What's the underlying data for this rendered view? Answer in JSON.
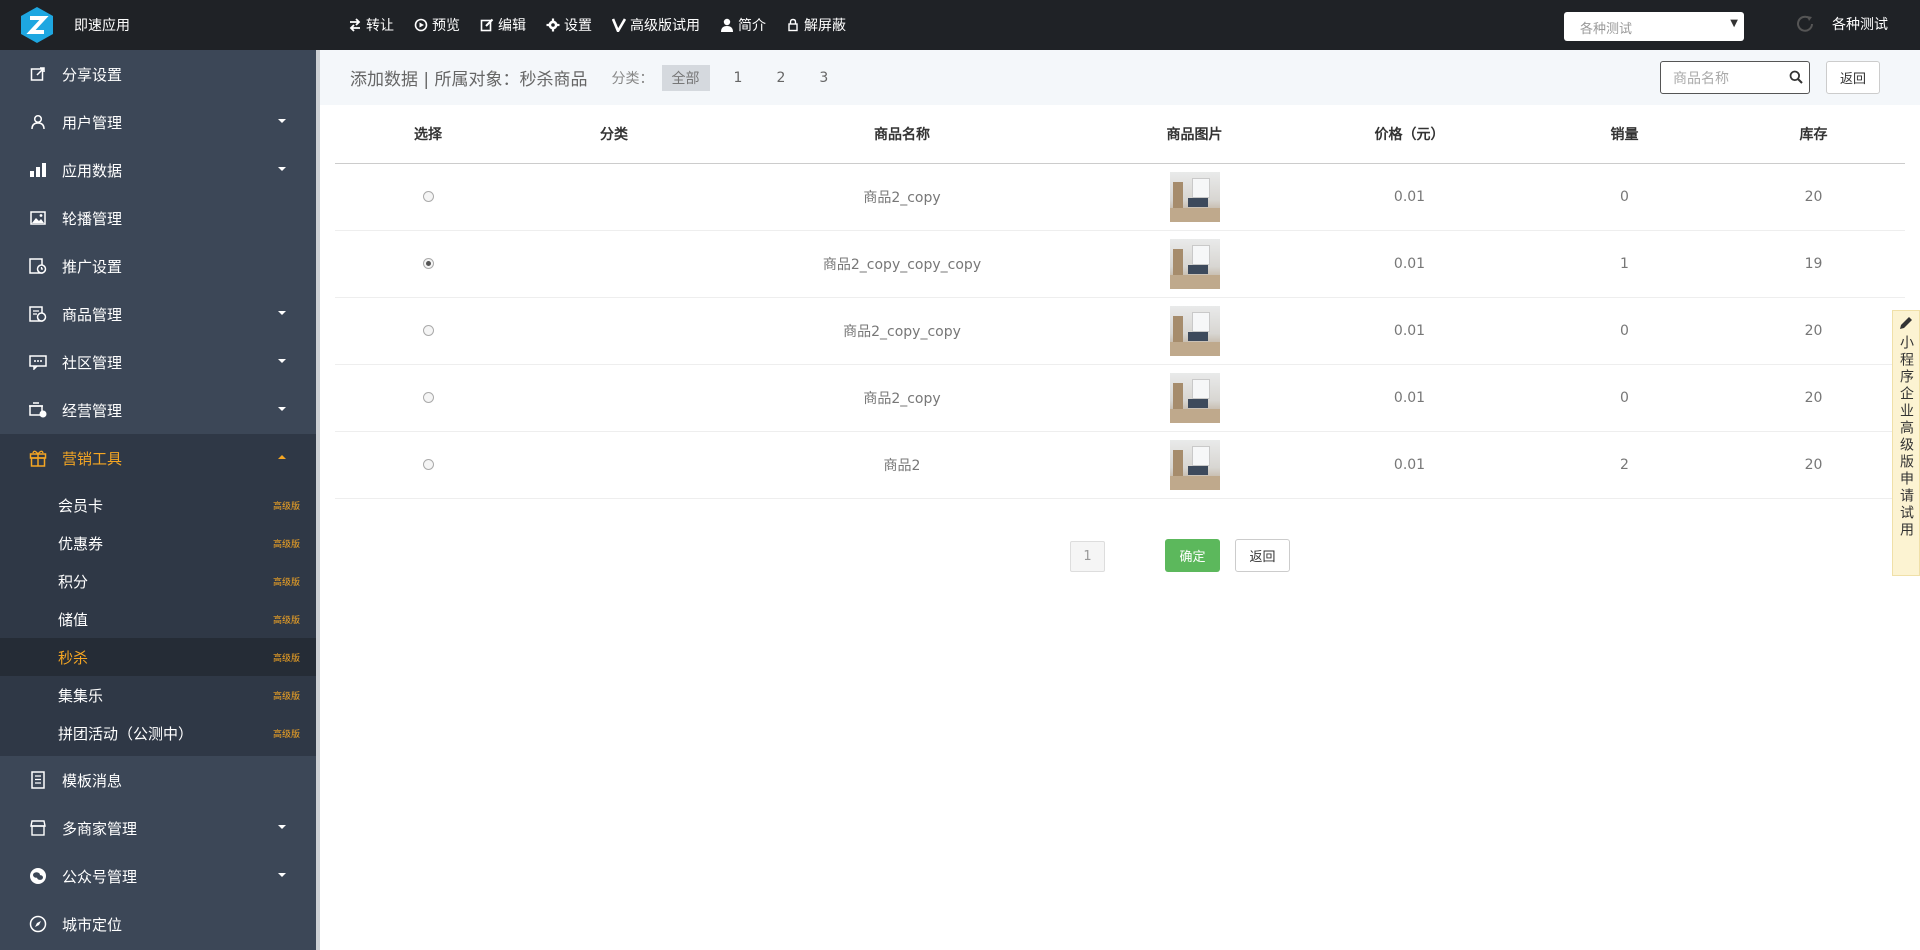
{
  "app": {
    "name": "即速应用",
    "accent": "#f5a623"
  },
  "topnav": [
    {
      "label": "转让",
      "icon": "transfer-icon"
    },
    {
      "label": "预览",
      "icon": "play-circle-icon"
    },
    {
      "label": "编辑",
      "icon": "edit-icon"
    },
    {
      "label": "设置",
      "icon": "gear-icon"
    },
    {
      "label": "高级版试用",
      "icon": "v-icon"
    },
    {
      "label": "简介",
      "icon": "user-icon"
    },
    {
      "label": "解屏蔽",
      "icon": "lock-icon"
    }
  ],
  "top_select": {
    "value": "各种测试"
  },
  "top_user": {
    "label": "各种测试"
  },
  "sidebar": {
    "items": [
      {
        "label": "分享设置",
        "icon": "share-icon",
        "has_arrow": false
      },
      {
        "label": "用户管理",
        "icon": "user-icon",
        "has_arrow": true
      },
      {
        "label": "应用数据",
        "icon": "bar-chart-icon",
        "has_arrow": true
      },
      {
        "label": "轮播管理",
        "icon": "image-icon",
        "has_arrow": false
      },
      {
        "label": "推广设置",
        "icon": "promote-icon",
        "has_arrow": false
      },
      {
        "label": "商品管理",
        "icon": "goods-icon",
        "has_arrow": true
      },
      {
        "label": "社区管理",
        "icon": "community-icon",
        "has_arrow": true
      },
      {
        "label": "经营管理",
        "icon": "business-icon",
        "has_arrow": true
      },
      {
        "label": "营销工具",
        "icon": "gift-icon",
        "has_arrow": true,
        "active": true
      }
    ],
    "sub_items": [
      {
        "label": "会员卡",
        "badge": "高级版"
      },
      {
        "label": "优惠券",
        "badge": "高级版"
      },
      {
        "label": "积分",
        "badge": "高级版"
      },
      {
        "label": "储值",
        "badge": "高级版"
      },
      {
        "label": "秒杀",
        "badge": "高级版",
        "active": true
      },
      {
        "label": "集集乐",
        "badge": "高级版"
      },
      {
        "label": "拼团活动（公测中）",
        "badge": "高级版"
      }
    ],
    "items_after": [
      {
        "label": "模板消息",
        "icon": "template-icon",
        "has_arrow": false
      },
      {
        "label": "多商家管理",
        "icon": "store-icon",
        "has_arrow": true
      },
      {
        "label": "公众号管理",
        "icon": "wechat-icon",
        "has_arrow": true
      },
      {
        "label": "城市定位",
        "icon": "compass-icon",
        "has_arrow": false
      }
    ]
  },
  "subheader": {
    "title": "添加数据 | 所属对象：秒杀商品",
    "category_label": "分类：",
    "categories": [
      "全部",
      "1",
      "2",
      "3"
    ],
    "search_placeholder": "商品名称",
    "back_label": "返回"
  },
  "table": {
    "headers": [
      "选择",
      "分类",
      "商品名称",
      "商品图片",
      "价格（元）",
      "销量",
      "库存"
    ],
    "rows": [
      {
        "selected": false,
        "category": "",
        "name": "商品2_copy",
        "price": "0.01",
        "sales": "0",
        "stock": "20"
      },
      {
        "selected": true,
        "category": "",
        "name": "商品2_copy_copy_copy",
        "price": "0.01",
        "sales": "1",
        "stock": "19"
      },
      {
        "selected": false,
        "category": "",
        "name": "商品2_copy_copy",
        "price": "0.01",
        "sales": "0",
        "stock": "20"
      },
      {
        "selected": false,
        "category": "",
        "name": "商品2_copy",
        "price": "0.01",
        "sales": "0",
        "stock": "20"
      },
      {
        "selected": false,
        "category": "",
        "name": "商品2",
        "price": "0.01",
        "sales": "2",
        "stock": "20"
      }
    ]
  },
  "pagination": {
    "current": "1"
  },
  "actions": {
    "confirm_label": "确定",
    "back_label": "返回"
  },
  "float_tab": {
    "label": "小程序企业高级版申请试用"
  }
}
